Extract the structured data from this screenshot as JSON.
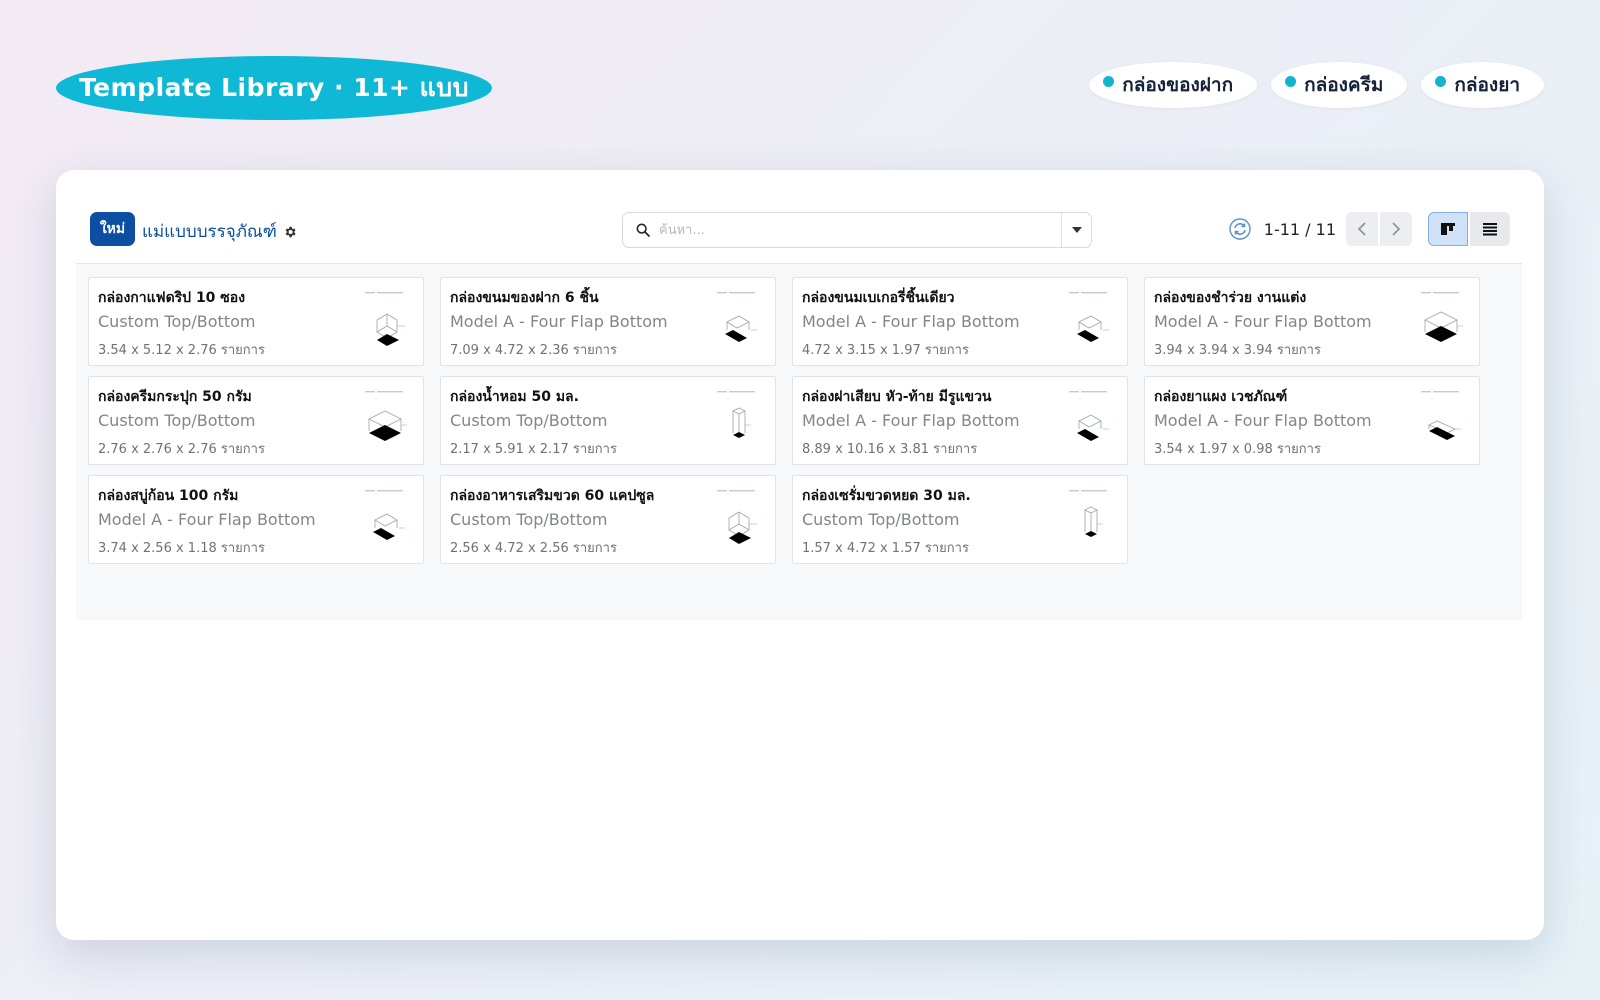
{
  "header": {
    "title": "Template Library · 11+ แบบ",
    "chips": [
      {
        "label": "กล่องของฝาก",
        "dot_color": "#12b3cf"
      },
      {
        "label": "กล่องครีม",
        "dot_color": "#12b3cf"
      },
      {
        "label": "กล่องยา",
        "dot_color": "#12b3cf"
      }
    ]
  },
  "control_panel": {
    "new_label": "ใหม่",
    "breadcrumb": "แม่แบบบรรจุภัณฑ์",
    "search_placeholder": "ค้นหา...",
    "pager_value": "1-11 / 11",
    "active_view": "kanban"
  },
  "cards": [
    {
      "name": "กล่องกาแฟดริป 10 ซอง",
      "type": "Custom Top/Bottom",
      "dims": "3.54 x 5.12 x 2.76 รายการ",
      "shape": "custom"
    },
    {
      "name": "กล่องขนมของฝาก 6 ชิ้น",
      "type": "Model A - Four Flap Bottom",
      "dims": "7.09 x 4.72 x 2.36 รายการ",
      "shape": "flap"
    },
    {
      "name": "กล่องขนมเบเกอรี่ชิ้นเดียว",
      "type": "Model A - Four Flap Bottom",
      "dims": "4.72 x 3.15 x 1.97 รายการ",
      "shape": "flap"
    },
    {
      "name": "กล่องของชำร่วย งานแต่ง",
      "type": "Model A - Four Flap Bottom",
      "dims": "3.94 x 3.94 x 3.94 รายการ",
      "shape": "cube"
    },
    {
      "name": "กล่องครีมกระปุก 50 กรัม",
      "type": "Custom Top/Bottom",
      "dims": "2.76 x 2.76 x 2.76 รายการ",
      "shape": "cube"
    },
    {
      "name": "กล่องน้ำหอม 50 มล.",
      "type": "Custom Top/Bottom",
      "dims": "2.17 x 5.91 x 2.17 รายการ",
      "shape": "tall"
    },
    {
      "name": "กล่องฝาเสียบ หัว-ท้าย มีรูแขวน",
      "type": "Model A - Four Flap Bottom",
      "dims": "8.89 x 10.16 x 3.81 รายการ",
      "shape": "flap"
    },
    {
      "name": "กล่องยาแผง เวชภัณฑ์",
      "type": "Model A - Four Flap Bottom",
      "dims": "3.54 x 1.97 x 0.98 รายการ",
      "shape": "flat"
    },
    {
      "name": "กล่องสบู่ก้อน 100 กรัม",
      "type": "Model A - Four Flap Bottom",
      "dims": "3.74 x 2.56 x 1.18 รายการ",
      "shape": "flap"
    },
    {
      "name": "กล่องอาหารเสริมขวด 60 แคปซูล",
      "type": "Custom Top/Bottom",
      "dims": "2.56 x 4.72 x 2.56 รายการ",
      "shape": "custom"
    },
    {
      "name": "กล่องเซรั่มขวดหยด 30 มล.",
      "type": "Custom Top/Bottom",
      "dims": "1.57 x 4.72 x 1.57 รายการ",
      "shape": "tall"
    }
  ]
}
